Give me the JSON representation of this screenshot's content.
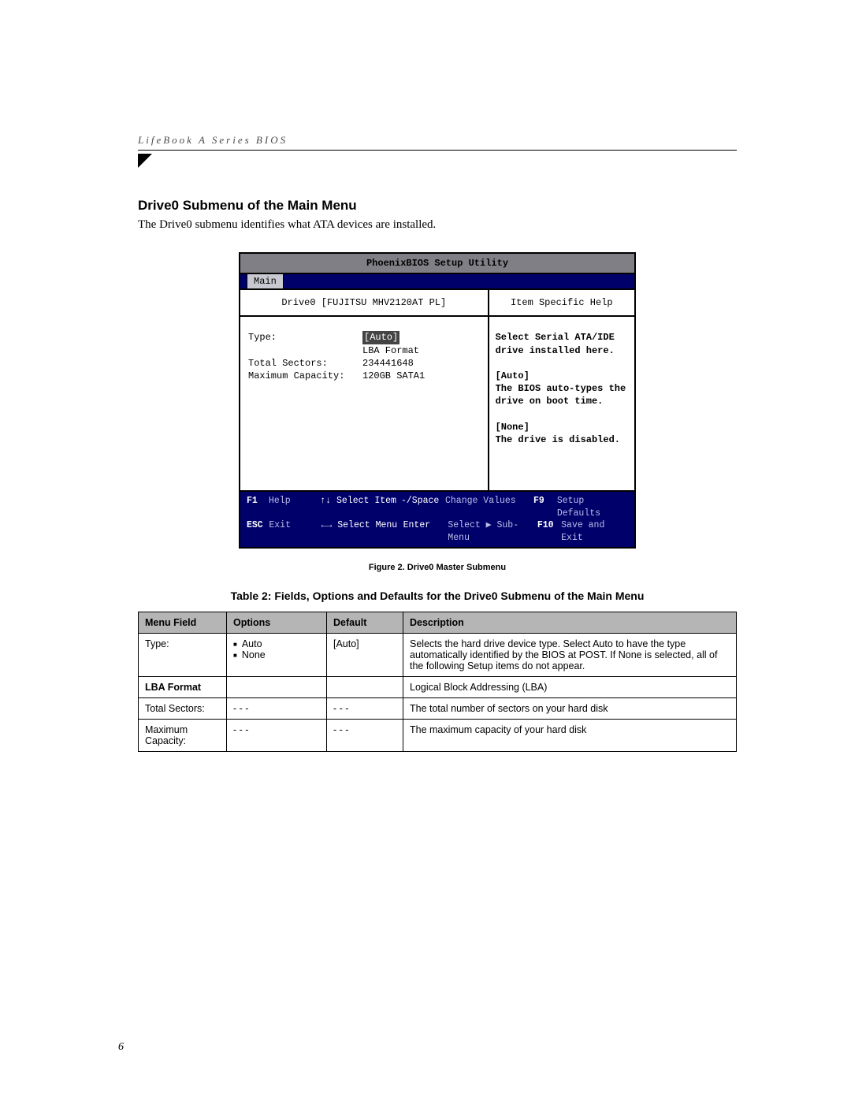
{
  "running_head": "LifeBook A Series BIOS",
  "section_title": "Drive0 Submenu of the Main Menu",
  "section_intro": "The Drive0 submenu identifies what ATA devices are installed.",
  "page_number": "6",
  "bios": {
    "utility_title": "PhoenixBIOS Setup Utility",
    "tab_main": "Main",
    "left_header": "Drive0 [FUJITSU MHV2120AT PL]",
    "right_header": "Item Specific Help",
    "rows": {
      "type_label": "Type:",
      "type_value": "[Auto]",
      "lba_value": "LBA Format",
      "sectors_label": "Total Sectors:",
      "sectors_value": "234441648",
      "maxcap_label": "Maximum Capacity:",
      "maxcap_value": "120GB SATA1"
    },
    "help": {
      "l1": "Select Serial ATA/IDE",
      "l2": "drive installed here.",
      "l3": "[Auto]",
      "l4": "The BIOS auto-types the",
      "l5": "drive on boot time.",
      "l6": "[None]",
      "l7": "The drive is disabled."
    },
    "footer": {
      "r1k1": "F1",
      "r1a1": "Help",
      "r1s1": "↑↓ Select Item",
      "r1s2": "-/Space",
      "r1a2": "Change Values",
      "r1k2": "F9",
      "r1a3": "Setup Defaults",
      "r2k1": "ESC",
      "r2a1": "Exit",
      "r2s1": "←→ Select Menu",
      "r2s2": "Enter",
      "r2a2": "Select ▶ Sub-Menu",
      "r2k2": "F10",
      "r2a3": "Save and Exit"
    }
  },
  "figure_caption": "Figure 2.  Drive0 Master Submenu",
  "table_caption": "Table 2: Fields, Options and Defaults for the Drive0 Submenu of the Main Menu",
  "headers": {
    "field": "Menu Field",
    "options": "Options",
    "default": "Default",
    "desc": "Description"
  },
  "rows": [
    {
      "field": "Type:",
      "opt1": "Auto",
      "opt2": "None",
      "default": "[Auto]",
      "desc": "Selects the hard drive device type. Select Auto to have the type automatically identified by the BIOS at POST. If None is selected, all of the following Setup items do not appear."
    },
    {
      "field": "LBA Format",
      "desc": "Logical Block Addressing (LBA)"
    },
    {
      "field": "Total Sectors:",
      "opt": "- - -",
      "default": "- - -",
      "desc": "The total number of sectors on your hard disk"
    },
    {
      "field": "Maximum Capacity:",
      "opt": "- - -",
      "default": "- - -",
      "desc": "The maximum capacity of your hard disk"
    }
  ]
}
